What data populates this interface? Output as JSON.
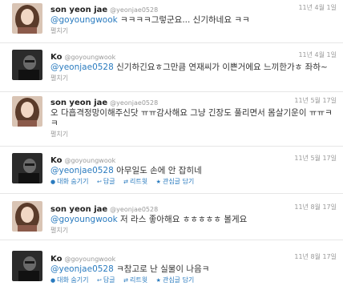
{
  "tweets": [
    {
      "name": "son yeon jae",
      "handle": "@yeonjae0528",
      "date": "11년 4월 1일",
      "mention": "@goyoungwook",
      "text": " ㅋㅋㅋㅋ그렇군요... 신기하네요 ㅋㅋ",
      "expand": "펼치기",
      "avatar": "woman"
    },
    {
      "name": "Ko",
      "handle": "@goyoungwook",
      "date": "11년 4월 1일",
      "mention": "@yeonjae0528",
      "text": " 신기하긴요ㅎ그만큼 연재씨가 이쁜거에요 느끼한가ㅎ 좌하~",
      "expand": "펼치기",
      "avatar": "man"
    },
    {
      "name": "son yeon jae",
      "handle": "@yeonjae0528",
      "date": "11년 5월 17일",
      "mention": "",
      "text": "오 다흡격정망이해주신닷 ㅠㅠ감사해요 그냥 긴장도 풀리면서 몸살기운이 ㅠㅠㅋㅋ",
      "expand": "펼치기",
      "avatar": "woman"
    },
    {
      "name": "Ko",
      "handle": "@goyoungwook",
      "date": "11년 5월 17일",
      "mention": "@yeonjae0528",
      "text": " 아무일도 손에 안 잡히네",
      "actions": [
        "대화 숨기기",
        "답글",
        "리트윗",
        "관심글 담기"
      ],
      "avatar": "man"
    },
    {
      "name": "son yeon jae",
      "handle": "@yeonjae0528",
      "date": "11년 8월 17일",
      "mention": "@goyoungwook",
      "text": " 저 라스 좋아해요 ㅎㅎㅎㅎㅎ 볼게요",
      "expand": "펼치기",
      "avatar": "woman"
    },
    {
      "name": "Ko",
      "handle": "@goyoungwook",
      "date": "11년 8월 17일",
      "mention": "@yeonjae0528",
      "text": " ㅋ참고로 난 실물이 나음ㅋ",
      "actions": [
        "대화 숨기기",
        "답글",
        "리트윗",
        "관심글 담기"
      ],
      "avatar": "man"
    }
  ],
  "icons": {
    "conversation": "conversation-icon",
    "reply": "reply-icon",
    "retweet": "retweet-icon",
    "favorite": "star-icon"
  },
  "colors": {
    "link": "#2a7bbf",
    "muted": "#999999",
    "text": "#333333"
  }
}
